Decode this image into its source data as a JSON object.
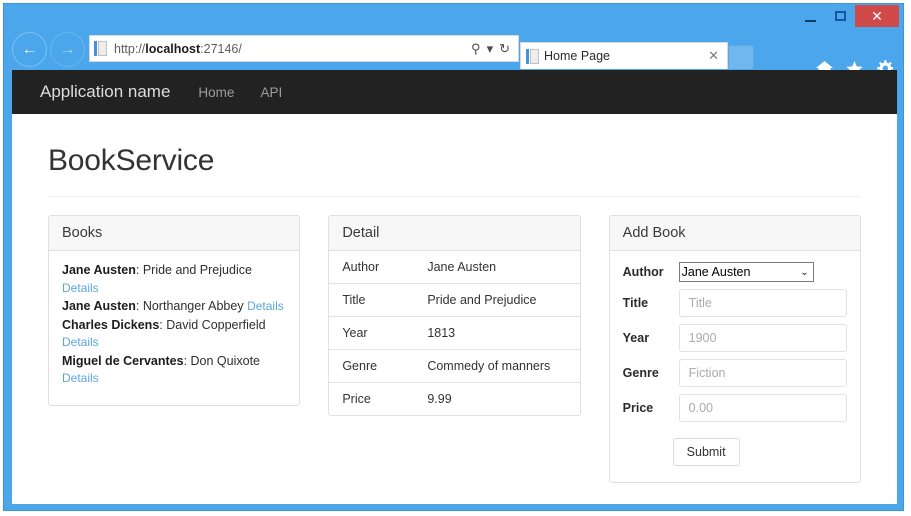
{
  "browser": {
    "url_prefix": "http://",
    "url_host": "localhost",
    "url_suffix": ":27146/",
    "tab_title": "Home Page",
    "tab_close_label": "✕",
    "search_icon": "⚲",
    "search_dropdown_icon": "▾",
    "refresh_icon": "↻",
    "back_icon": "←",
    "forward_icon": "→",
    "home_icon": "⌂",
    "favorites_icon": "★",
    "settings_icon": "⚙",
    "minimize_label": "",
    "maximize_label": "",
    "close_label": "✕",
    "close_color": "#d04a4a",
    "frame_color": "#4ba6eb"
  },
  "navbar": {
    "brand": "Application name",
    "links": [
      {
        "label": "Home"
      },
      {
        "label": "API"
      }
    ]
  },
  "page": {
    "title": "BookService"
  },
  "books_panel": {
    "title": "Books",
    "details_label": "Details",
    "items": [
      {
        "author": "Jane Austen",
        "separator": ": ",
        "title": "Pride and Prejudice"
      },
      {
        "author": "Jane Austen",
        "separator": ": ",
        "title": "Northanger Abbey"
      },
      {
        "author": "Charles Dickens",
        "separator": ": ",
        "title": "David Copperfield"
      },
      {
        "author": "Miguel de Cervantes",
        "separator": ": ",
        "title": "Don Quixote"
      }
    ]
  },
  "detail_panel": {
    "title": "Detail",
    "rows": [
      {
        "label": "Author",
        "value": "Jane Austen"
      },
      {
        "label": "Title",
        "value": "Pride and Prejudice"
      },
      {
        "label": "Year",
        "value": "1813"
      },
      {
        "label": "Genre",
        "value": "Commedy of manners"
      },
      {
        "label": "Price",
        "value": "9.99"
      }
    ]
  },
  "add_book_panel": {
    "title": "Add Book",
    "author_label": "Author",
    "author_value": "Jane Austen",
    "author_arrow": "⌄",
    "fields": [
      {
        "label": "Title",
        "placeholder": "Title",
        "value": ""
      },
      {
        "label": "Year",
        "placeholder": "1900",
        "value": ""
      },
      {
        "label": "Genre",
        "placeholder": "Fiction",
        "value": ""
      },
      {
        "label": "Price",
        "placeholder": "0.00",
        "value": ""
      }
    ],
    "submit_label": "Submit"
  },
  "colors": {
    "link": "#5ba7dd",
    "navbar_bg": "#222222",
    "panel_heading_bg": "#f7f7f7"
  }
}
